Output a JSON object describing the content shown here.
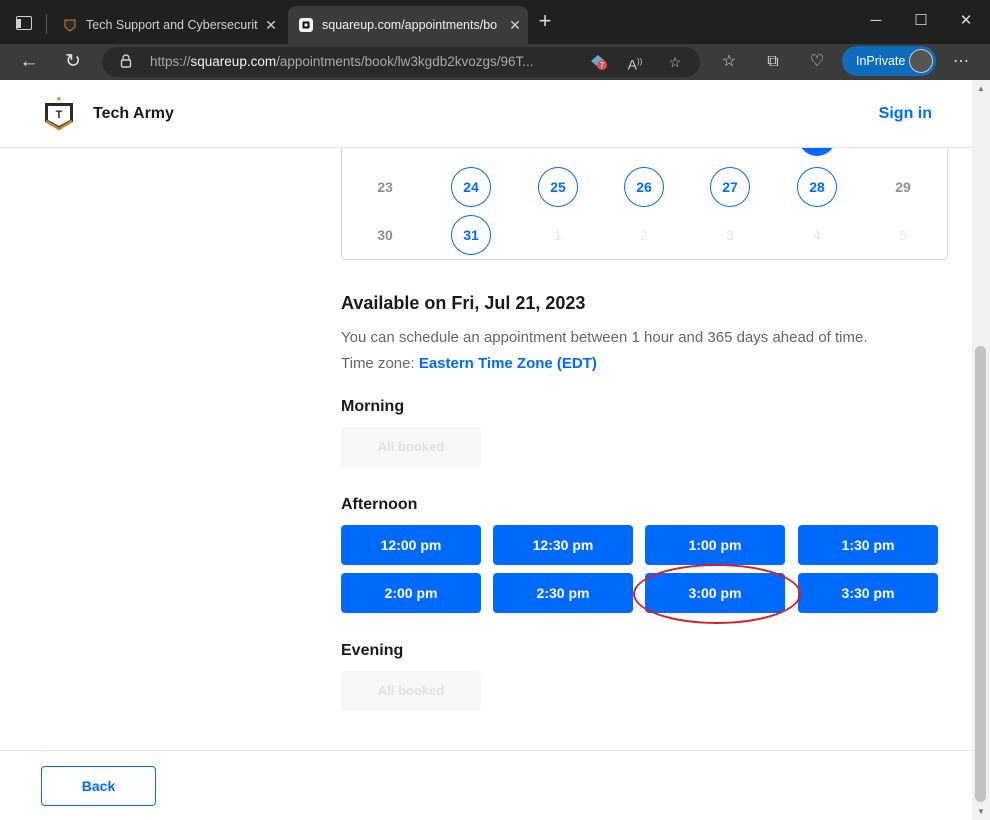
{
  "browser": {
    "tabs": [
      {
        "title": "Tech Support and Cybersecurity",
        "active": false
      },
      {
        "title": "squareup.com/appointments/bo",
        "active": true
      }
    ],
    "url_domain": "squareup.com",
    "url_prefix": "https://",
    "url_path": "/appointments/book/lw3kgdb2kvozgs/96T...",
    "ext_badge_count": "7",
    "inprivate_label": "InPrivate"
  },
  "header": {
    "brand_name": "Tech Army",
    "sign_in_label": "Sign in"
  },
  "calendar": {
    "weeks": [
      [
        {
          "day": "23",
          "state": "past"
        },
        {
          "day": "24",
          "state": "available"
        },
        {
          "day": "25",
          "state": "available"
        },
        {
          "day": "26",
          "state": "available"
        },
        {
          "day": "27",
          "state": "available"
        },
        {
          "day": "28",
          "state": "available"
        },
        {
          "day": "29",
          "state": "past"
        }
      ],
      [
        {
          "day": "30",
          "state": "past"
        },
        {
          "day": "31",
          "state": "available"
        },
        {
          "day": "1",
          "state": "next-month"
        },
        {
          "day": "2",
          "state": "next-month"
        },
        {
          "day": "3",
          "state": "next-month"
        },
        {
          "day": "4",
          "state": "next-month"
        },
        {
          "day": "5",
          "state": "next-month"
        }
      ]
    ],
    "accent_color": "#006aff"
  },
  "availability": {
    "title": "Available on Fri, Jul 21, 2023",
    "note": "You can schedule an appointment between 1 hour and 365 days ahead of time.",
    "timezone_label": "Time zone:",
    "timezone_value": "Eastern Time Zone (EDT)"
  },
  "morning": {
    "label": "Morning",
    "booked_label": "All booked"
  },
  "afternoon": {
    "label": "Afternoon",
    "slots": [
      "12:00 pm",
      "12:30 pm",
      "1:00 pm",
      "1:30 pm",
      "2:00 pm",
      "2:30 pm",
      "3:00 pm",
      "3:30 pm"
    ],
    "highlighted_slot": "3:00 pm"
  },
  "evening": {
    "label": "Evening",
    "booked_label": "All booked"
  },
  "footer": {
    "back_label": "Back"
  }
}
